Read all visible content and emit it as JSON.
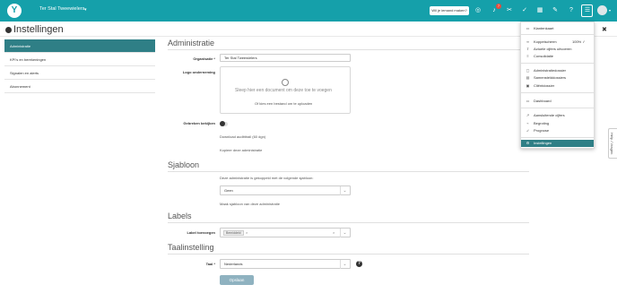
{
  "header": {
    "company": "Ter Stal Tweewielers",
    "help_pill": "Wil je iemand maken?",
    "notification_count": "7",
    "icons": [
      "compass-icon",
      "bell-icon",
      "scissors-icon",
      "check-circle-icon",
      "table-icon",
      "grid-icon",
      "wrench-icon",
      "help-icon",
      "menu-icon",
      "avatar"
    ],
    "accent": "#15a0aa"
  },
  "page": {
    "title": "Instellingen",
    "close_label": "",
    "close": "✖"
  },
  "sidebar": {
    "items": [
      {
        "label": "Administratie",
        "active": true
      },
      {
        "label": "KPI's en berekeningen",
        "active": false
      },
      {
        "label": "Signalen en alerts",
        "active": false
      },
      {
        "label": "Abonnement",
        "active": false
      }
    ],
    "active_color": "#2f7f86"
  },
  "administratie": {
    "title": "Administratie",
    "org_label": "Organisatie *",
    "org_value": "Ter Stal Tweewielers",
    "logo_label": "Logo onderneming",
    "drop_text": "Sleep hier een document om deze toe te voegen",
    "drop_link": "Of kies een bestand om te uploaden",
    "gebreken_label": "Gebreken bekijken",
    "link_download": "Download auditttrail (60 dgn)",
    "link_copy": "Kopieer deze administratie"
  },
  "sjabloon": {
    "title": "Sjabloon",
    "desc": "Deze administratie is gekoppeld met de volgende sjabloon:",
    "value": "Geen",
    "link": "Maak sjabloon van deze administratie"
  },
  "labels": {
    "title": "Labels",
    "add_label": "Label toevoegen",
    "chip": "Bemiddeld"
  },
  "taal": {
    "title": "Taalinstelling",
    "label": "Taal *",
    "value": "Nederlands"
  },
  "save_label": "Opslaan",
  "menu": {
    "items": [
      {
        "icon": "id-card-icon",
        "glyph": "▭",
        "label": "Klantenkaart"
      },
      {
        "icon": "link-icon",
        "glyph": "∞",
        "label": "Koppelscherm",
        "extra": "100% ✓"
      },
      {
        "icon": "upload-icon",
        "glyph": "⇪",
        "label": "Actuele cijfers uitvoeren"
      },
      {
        "icon": "layers-icon",
        "glyph": "≡",
        "label": "Consolidatie"
      },
      {
        "icon": "folder-icon",
        "glyph": "▢",
        "label": "Administratiedossier"
      },
      {
        "icon": "folder-icon",
        "glyph": "▤",
        "label": "Samenstelddossiers"
      },
      {
        "icon": "folder-icon",
        "glyph": "▣",
        "label": "Cliëntdossier"
      },
      {
        "icon": "dashboard-icon",
        "glyph": "▭",
        "label": "Dashboard"
      },
      {
        "icon": "chart-icon",
        "glyph": "↗",
        "label": "Aansluitende cijfers"
      },
      {
        "icon": "budget-icon",
        "glyph": "⌁",
        "label": "Begroting"
      },
      {
        "icon": "forecast-icon",
        "glyph": "➶",
        "label": "Prognose"
      },
      {
        "icon": "gear-icon",
        "glyph": "⚙",
        "label": "Instellingen",
        "active": true
      }
    ]
  },
  "side_tab": "Help / Vragen"
}
